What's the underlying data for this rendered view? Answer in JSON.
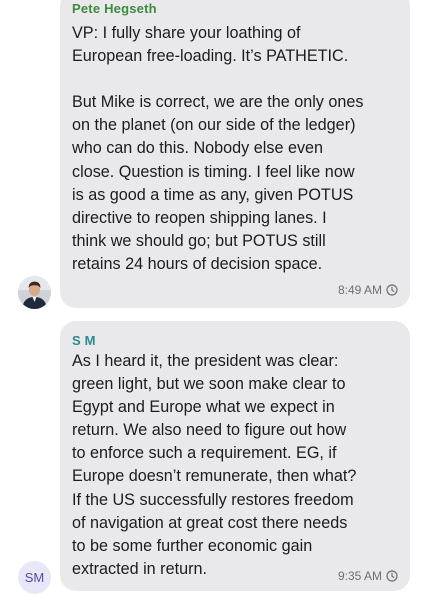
{
  "messages": [
    {
      "sender": "Pete Hegseth",
      "sender_color": "#3f8a3f",
      "text": "VP: I fully share your loathing of\nEuropean free-loading. It’s PATHETIC.\n\nBut Mike is correct, we are the only ones\non the planet (on our side of the ledger)\nwho can do this. Nobody else even\nclose. Question is timing. I feel like now\nis as good a time as any, given POTUS\ndirective to reopen shipping lanes. I\nthink we should go; but POTUS still\nretains 24 hours of decision space.",
      "time": "8:49 AM",
      "status_icon": "clock-icon",
      "avatar": "profile-photo"
    },
    {
      "sender": "S M",
      "sender_color": "#2e8a8a",
      "text": "As I heard it, the president was clear:\ngreen light, but we soon make clear to\nEgypt and Europe what we expect in\nreturn. We also need to figure out how\nto enforce such a requirement. EG, if\nEurope doesn’t remunerate, then what?\nIf the US successfully restores freedom\nof navigation at great cost there needs\nto be some further economic gain\nextracted in return.",
      "time": "9:35 AM",
      "status_icon": "clock-icon",
      "avatar_initials": "SM"
    }
  ],
  "colors": {
    "bubble_background": "#e9e9eb",
    "message_text": "#1c1c1e",
    "timestamp": "#6e6e73",
    "initials_avatar_background": "#e7e7f8",
    "initials_avatar_text": "#4f4fa3"
  }
}
